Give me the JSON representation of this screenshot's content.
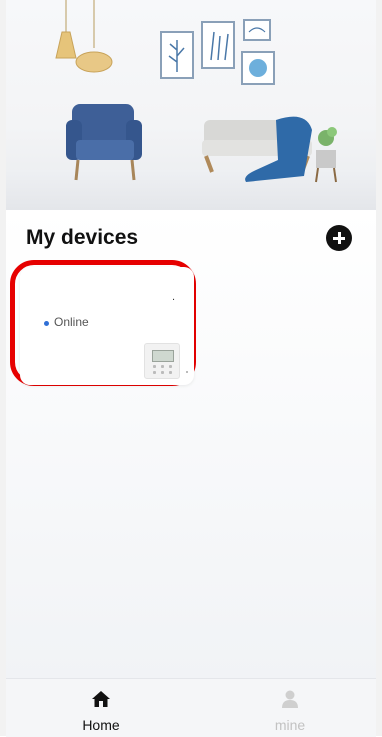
{
  "section": {
    "title": "My devices"
  },
  "device": {
    "name": ".",
    "status": "Online",
    "status_color": "#2f6fd6",
    "icon": "thermostat-icon"
  },
  "tabs": [
    {
      "label": "Home",
      "icon": "home-icon",
      "active": true
    },
    {
      "label": "mine",
      "icon": "user-icon",
      "active": false
    }
  ],
  "colors": {
    "highlight": "#e60000",
    "accent": "#111111"
  }
}
